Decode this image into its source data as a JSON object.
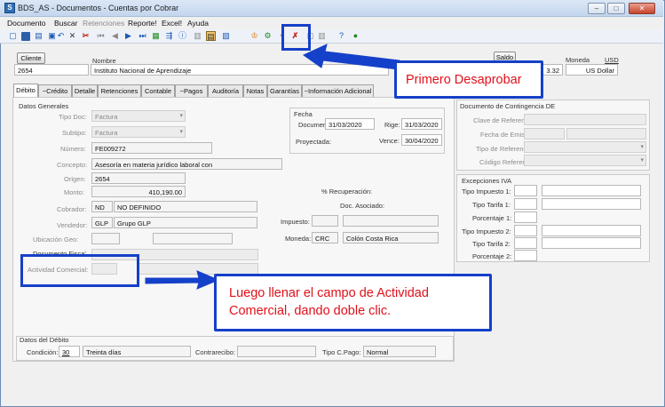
{
  "window": {
    "title": "BDS_AS - Documentos - Cuentas por Cobrar",
    "app_icon": "S"
  },
  "menu": [
    "Documento",
    "Buscar",
    "Retenciones",
    "Reporte!",
    "Excel!",
    "Ayuda"
  ],
  "header": {
    "cliente_button": "Cliente",
    "nombre_label": "Nombre",
    "cliente_value": "2654",
    "nombre_value": "Instituto Nacional de Aprendizaje",
    "saldo_button": "Saldo",
    "saldo_value": "3.32",
    "moneda_label": "Moneda",
    "moneda_code": "USD",
    "moneda_value": "US Dollar"
  },
  "tabs": [
    "Débito",
    "~Crédito",
    "Detalle",
    "Retenciones",
    "Contable",
    "~Pagos",
    "Auditoría",
    "Notas",
    "Garantías",
    "~Información Adicional"
  ],
  "datos_generales": {
    "title": "Datos Generales",
    "tipo_doc_label": "Tipo Doc:",
    "tipo_doc_value": "Factura",
    "subtipo_label": "Subtipo:",
    "subtipo_value": "Factura",
    "numero_label": "Número:",
    "numero_value": "FE009272",
    "concepto_label": "Concepto:",
    "concepto_value": "Asesoría en materia jurídico laboral con",
    "origen_label": "Origen:",
    "origen_value": "2654",
    "monto_label": "Monto:",
    "monto_value": "410,190.00",
    "cobrador_label": "Cobrador:",
    "cobrador_code": "ND",
    "cobrador_value": "NO DEFINIDO",
    "vendedor_label": "Vendedor:",
    "vendedor_code": "GLP",
    "vendedor_value": "Grupo GLP",
    "ubicacion_label": "Ubicación Geo:",
    "documento_fisca_label": "Documento Fisca'",
    "actividad_label": "Actividad Comercial:"
  },
  "fecha": {
    "title": "Fecha",
    "documento_label": "Documento:",
    "documento_value": "31/03/2020",
    "rige_label": "Rige:",
    "rige_value": "31/03/2020",
    "proyectada_label": "Proyectada:",
    "vence_label": "Vence:",
    "vence_value": "30/04/2020"
  },
  "extra": {
    "recuperacion_label": "% Recuperación:",
    "doc_asociado_label": "Doc. Asociado:",
    "impuesto_label": "Impuesto:",
    "moneda_label": "Moneda:",
    "moneda_code": "CRC",
    "moneda_value": "Colón Costa Rica"
  },
  "contingencia": {
    "title": "Documento de Contingencia DE",
    "clave_label": "Clave de Referencia:",
    "fecha_label": "Fecha de Emisión:",
    "tipo_label": "Tipo de Referencia:",
    "codigo_label": "Código Referencia:"
  },
  "excepciones": {
    "title": "Excepciones IVA",
    "tipo_impuesto_1": "Tipo Impuesto 1:",
    "tipo_tarifa_1": "Tipo Tarifa 1:",
    "porcentaje_1": "Porcentaje 1:",
    "tipo_impuesto_2": "Tipo Impuesto 2:",
    "tipo_tarifa_2": "Tipo Tarifa 2:",
    "porcentaje_2": "Porcentaje 2:"
  },
  "datos_debito": {
    "title": "Datos del Débito",
    "condicion_label": "Condición:",
    "condicion_code": "30",
    "condicion_value": "Treinta días",
    "contrarecibo_label": "Contrarecibo:",
    "tipo_pago_label": "Tipo C.Pago:",
    "tipo_pago_value": "Normal"
  },
  "callouts": {
    "primero": "Primero Desaprobar",
    "luego": "Luego llenar el campo de Actividad Comercial, dando doble clic."
  },
  "colors": {
    "annotation_blue": "#1540c9",
    "annotation_text": "#e0101a"
  }
}
